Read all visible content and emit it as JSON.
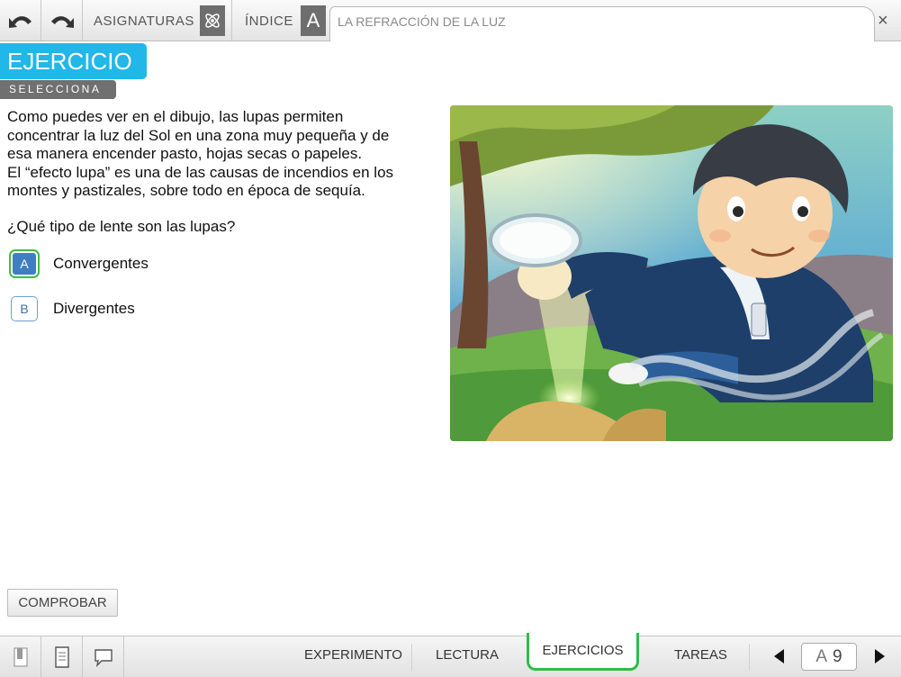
{
  "topbar": {
    "nav_subjects": "ASIGNATURAS",
    "nav_index": "ÍNDICE",
    "index_letter": "A",
    "title": "LA REFRACCIÓN DE LA LUZ",
    "close_symbol": "×"
  },
  "header": {
    "badge": "EJERCICIO",
    "sub_badge": "SELECCIONA"
  },
  "exercise": {
    "paragraph_lines": [
      "Como puedes ver en el dibujo, las lupas permiten",
      "concentrar la luz del Sol en una zona muy pequeña y de",
      "esa manera encender pasto, hojas secas o papeles.",
      "El “efecto lupa” es una de las causas de incendios en los",
      "montes y pastizales, sobre todo en época de sequía."
    ],
    "question": "¿Qué tipo de lente son las lupas?",
    "options": [
      {
        "key": "A",
        "label": "Convergentes",
        "selected": true
      },
      {
        "key": "B",
        "label": "Divergentes",
        "selected": false
      }
    ],
    "check_button": "COMPROBAR"
  },
  "bottombar": {
    "tabs": [
      "EXPERIMENTO",
      "LECTURA",
      "EJERCICIOS",
      "TAREAS"
    ],
    "active_tab": "EJERCICIOS",
    "page_letter": "A",
    "page_number": "9"
  },
  "colors": {
    "accent_blue": "#21b7e8",
    "badge_gray": "#707070",
    "active_green": "#2ebd4a",
    "option_blue": "#3f7ec2"
  },
  "icons": [
    "undo-icon",
    "redo-icon",
    "atom-icon",
    "close-icon",
    "bookmark-icon",
    "notebook-icon",
    "speech-bubble-icon",
    "prev-page-icon",
    "next-page-icon"
  ]
}
